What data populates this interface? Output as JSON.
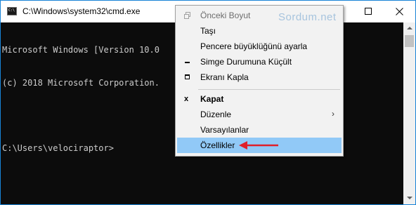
{
  "window": {
    "title": "C:\\Windows\\system32\\cmd.exe",
    "accent_color": "#1883d7"
  },
  "console": {
    "lines": [
      "Microsoft Windows [Version 10.0",
      "(c) 2018 Microsoft Corporation.",
      "",
      "C:\\Users\\velociraptor>"
    ],
    "background": "#0c0c0c",
    "text_color": "#cccccc"
  },
  "context_menu": {
    "watermark": "Sordum.net",
    "items": [
      {
        "label": "Önceki Boyut",
        "icon": "restore-icon",
        "disabled": true
      },
      {
        "label": "Taşı"
      },
      {
        "label": "Pencere büyüklüğünü ayarla"
      },
      {
        "label": "Simge Durumuna Küçült",
        "icon": "minimize-icon"
      },
      {
        "label": "Ekranı Kapla",
        "icon": "maximize-icon"
      },
      {
        "label": "Kapat",
        "icon": "close-icon",
        "icon_glyph": "x",
        "bold": true
      },
      {
        "label": "Düzenle",
        "submenu": true,
        "submenu_glyph": "›"
      },
      {
        "label": "Varsayılanlar"
      },
      {
        "label": "Özellikler",
        "selected": true
      }
    ],
    "selected_color": "#91c9f7",
    "annotation_color": "#e0202a"
  }
}
